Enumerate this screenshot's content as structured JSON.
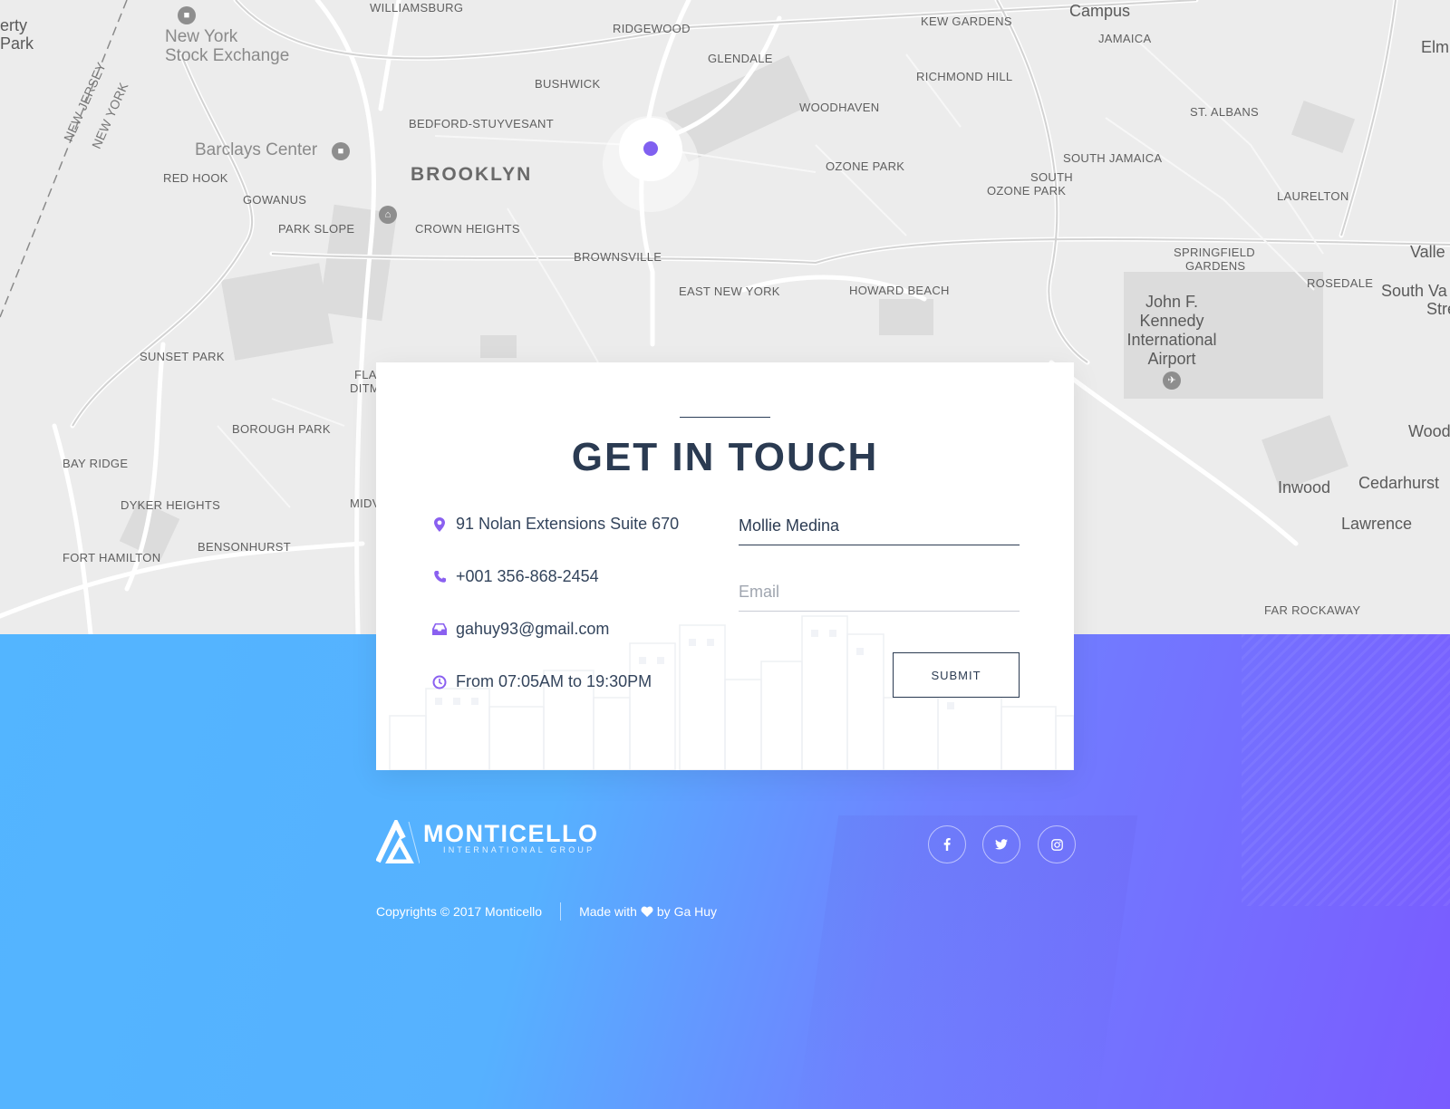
{
  "map": {
    "labels": {
      "williamsburg": "WILLIAMSBURG",
      "ridgewood": "RIDGEWOOD",
      "kew_gardens": "KEW GARDENS",
      "campus": "Campus",
      "jamaica": "JAMAICA",
      "elm": "Elm",
      "glendale": "GLENDALE",
      "richmond_hill": "RICHMOND HILL",
      "bushwick": "BUSHWICK",
      "woodhaven": "WOODHAVEN",
      "st_albans": "ST. ALBANS",
      "bed_stuy": "BEDFORD-STUYVESANT",
      "barclays": "Barclays Center",
      "brooklyn": "BROOKLYN",
      "ozone_park": "OZONE PARK",
      "south_jamaica": "SOUTH JAMAICA",
      "south_ozone_1": "SOUTH",
      "south_ozone_2": "OZONE PARK",
      "laurelton": "LAURELTON",
      "red_hook": "RED HOOK",
      "gowanus": "GOWANUS",
      "park_slope": "PARK SLOPE",
      "crown_heights": "CROWN HEIGHTS",
      "brownsville": "BROWNSVILLE",
      "springfield_1": "SPRINGFIELD",
      "springfield_2": "GARDENS",
      "valley": "Valle",
      "east_new_york": "EAST NEW YORK",
      "howard_beach": "HOWARD BEACH",
      "rosedale": "ROSEDALE",
      "south_valley_1": "South Va",
      "south_valley_2": "Strean",
      "jfk_1": "John F.",
      "jfk_2": "Kennedy",
      "jfk_3": "International",
      "jfk_4": "Airport",
      "sunset_park": "SUNSET PARK",
      "flat_1": "FLA",
      "flat_2": "DITM",
      "borough_park": "BOROUGH PARK",
      "wood": "Wood",
      "bay_ridge": "BAY RIDGE",
      "inwood": "Inwood",
      "cedarhurst": "Cedarhurst",
      "dyker_heights": "DYKER HEIGHTS",
      "midw": "MIDV",
      "lawrence": "Lawrence",
      "bensonhurst": "BENSONHURST",
      "fort_hamilton": "FORT HAMILTON",
      "far_rockaway": "FAR ROCKAWAY",
      "liberty_1": "erty",
      "liberty_2": "Park",
      "nyse_1": "New York",
      "nyse_2": "Stock Exchange",
      "new_jersey": "NEW JERSEY",
      "new_york": "NEW YORK"
    },
    "pin_color": "#8060f0"
  },
  "contact": {
    "title": "GET IN TOUCH",
    "address": "91 Nolan Extensions Suite 670",
    "phone": "+001 356-868-2454",
    "email": "gahuy93@gmail.com",
    "hours": "From 07:05AM to 19:30PM",
    "icon_color": "#8a60f0"
  },
  "form": {
    "name_value": "Mollie Medina",
    "email_placeholder": "Email",
    "submit_label": "SUBMIT"
  },
  "footer": {
    "brand_name": "MONTICELLO",
    "brand_tagline": "INTERNATIONAL GROUP",
    "copyright": "Copyrights © 2017 Monticello",
    "made_with_prefix": "Made with",
    "made_with_suffix": "by Ga Huy",
    "social": [
      "facebook-icon",
      "twitter-icon",
      "instagram-icon"
    ]
  }
}
